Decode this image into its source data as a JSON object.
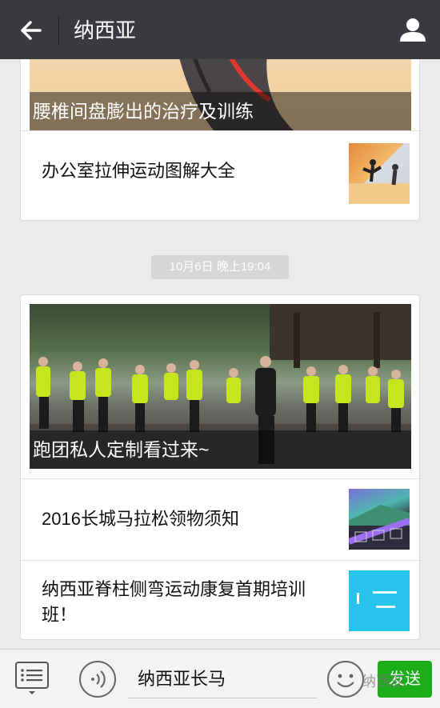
{
  "header": {
    "title": "纳西亚"
  },
  "feed": {
    "card1": {
      "cover_caption": "腰椎间盘膨出的治疗及训练",
      "articles": [
        {
          "title": "办公室拉伸运动图解大全"
        }
      ]
    },
    "timestamp": "10月6日 晚上19:04",
    "card2": {
      "cover_caption": "跑团私人定制看过来~",
      "articles": [
        {
          "title": "2016长城马拉松领物须知"
        },
        {
          "title": "纳西亚脊柱侧弯运动康复首期培训班！"
        }
      ]
    }
  },
  "input": {
    "value": "纳西亚长马",
    "send_label": "发送"
  },
  "watermark": "纳西亚",
  "colors": {
    "topbar": "#393a3f",
    "send": "#1aad19",
    "background": "#ebebeb"
  }
}
